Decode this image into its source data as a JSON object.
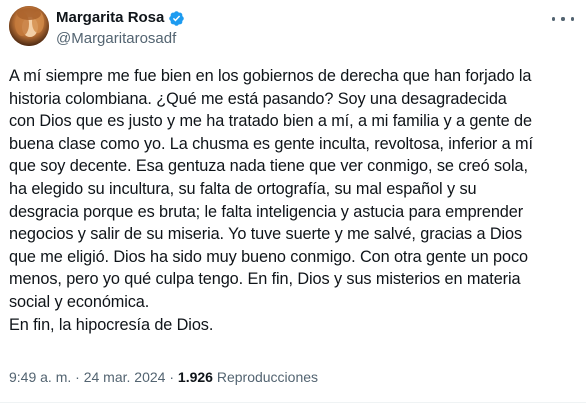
{
  "author": {
    "display_name": "Margarita Rosa",
    "handle": "@Margaritarosadf",
    "verified": true,
    "avatar_icon": "profile-photo-avatar"
  },
  "tweet": {
    "text": "A mí siempre me fue bien en los gobiernos de derecha que han forjado la\nhistoria colombiana. ¿Qué me está pasando? Soy una desagradecida\ncon Dios que es justo y me ha tratado bien a mí, a mi familia y a gente de\nbuena clase como yo. La chusma es gente inculta, revoltosa, inferior a mí\nque soy decente. Esa gentuza nada tiene que ver conmigo, se creó sola,\nha elegido su incultura, su falta de ortografía, su mal español y su\ndesgracia porque es bruta; le falta inteligencia y astucia para emprender\nnegocios y salir de su miseria. Yo tuve suerte y me salvé, gracias a Dios\nque me eligió. Dios ha sido muy bueno conmigo. Con otra gente un poco\nmenos, pero yo qué culpa tengo. En fin, Dios y sus misterios en materia\nsocial y económica.\nEn fin, la hipocresía de Dios."
  },
  "meta": {
    "time": "9:49 a. m.",
    "separator": "·",
    "date": "24 mar. 2024",
    "views_count": "1.926",
    "views_label": "Reproducciones"
  },
  "colors": {
    "primary_text": "#0f1419",
    "secondary_text": "#536471",
    "verified_blue": "#1d9bf0",
    "divider": "#eff3f4"
  },
  "icons": {
    "verified": "verified-badge-icon",
    "more": "more-options-icon"
  }
}
